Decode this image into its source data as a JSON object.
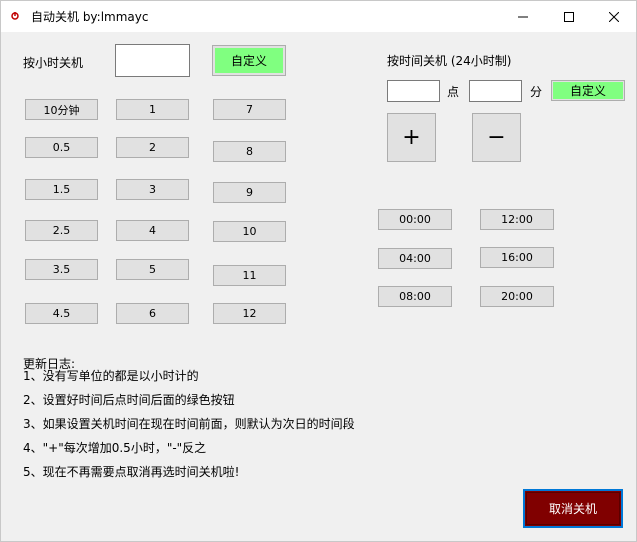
{
  "window": {
    "title": "自动关机 by:lmmayc"
  },
  "hours_section": {
    "label": "按小时关机",
    "custom_button": "自定义",
    "col1": [
      "10分钟",
      "0.5",
      "1.5",
      "2.5",
      "3.5",
      "4.5"
    ],
    "col2": [
      "1",
      "2",
      "3",
      "4",
      "5",
      "6"
    ],
    "col3": [
      "7",
      "8",
      "9",
      "10",
      "11",
      "12"
    ]
  },
  "time_section": {
    "label": "按时间关机 (24小时制)",
    "hour_unit": "点",
    "minute_unit": "分",
    "custom_button": "自定义",
    "plus": "+",
    "minus": "−",
    "presets_left": [
      "00:00",
      "04:00",
      "08:00"
    ],
    "presets_right": [
      "12:00",
      "16:00",
      "20:00"
    ]
  },
  "changelog": {
    "title": "更新日志:",
    "lines": [
      "1、没有写单位的都是以小时计的",
      "2、设置好时间后点时间后面的绿色按钮",
      "3、如果设置关机时间在现在时间前面，则默认为次日的时间段",
      "4、\"+\"每次增加0.5小时，\"-\"反之",
      "5、现在不再需要点取消再选时间关机啦!"
    ]
  },
  "cancel_button": "取消关机",
  "colors": {
    "accent_green": "#80ff80",
    "cancel_red": "#800000",
    "focus_blue": "#0078d7"
  }
}
